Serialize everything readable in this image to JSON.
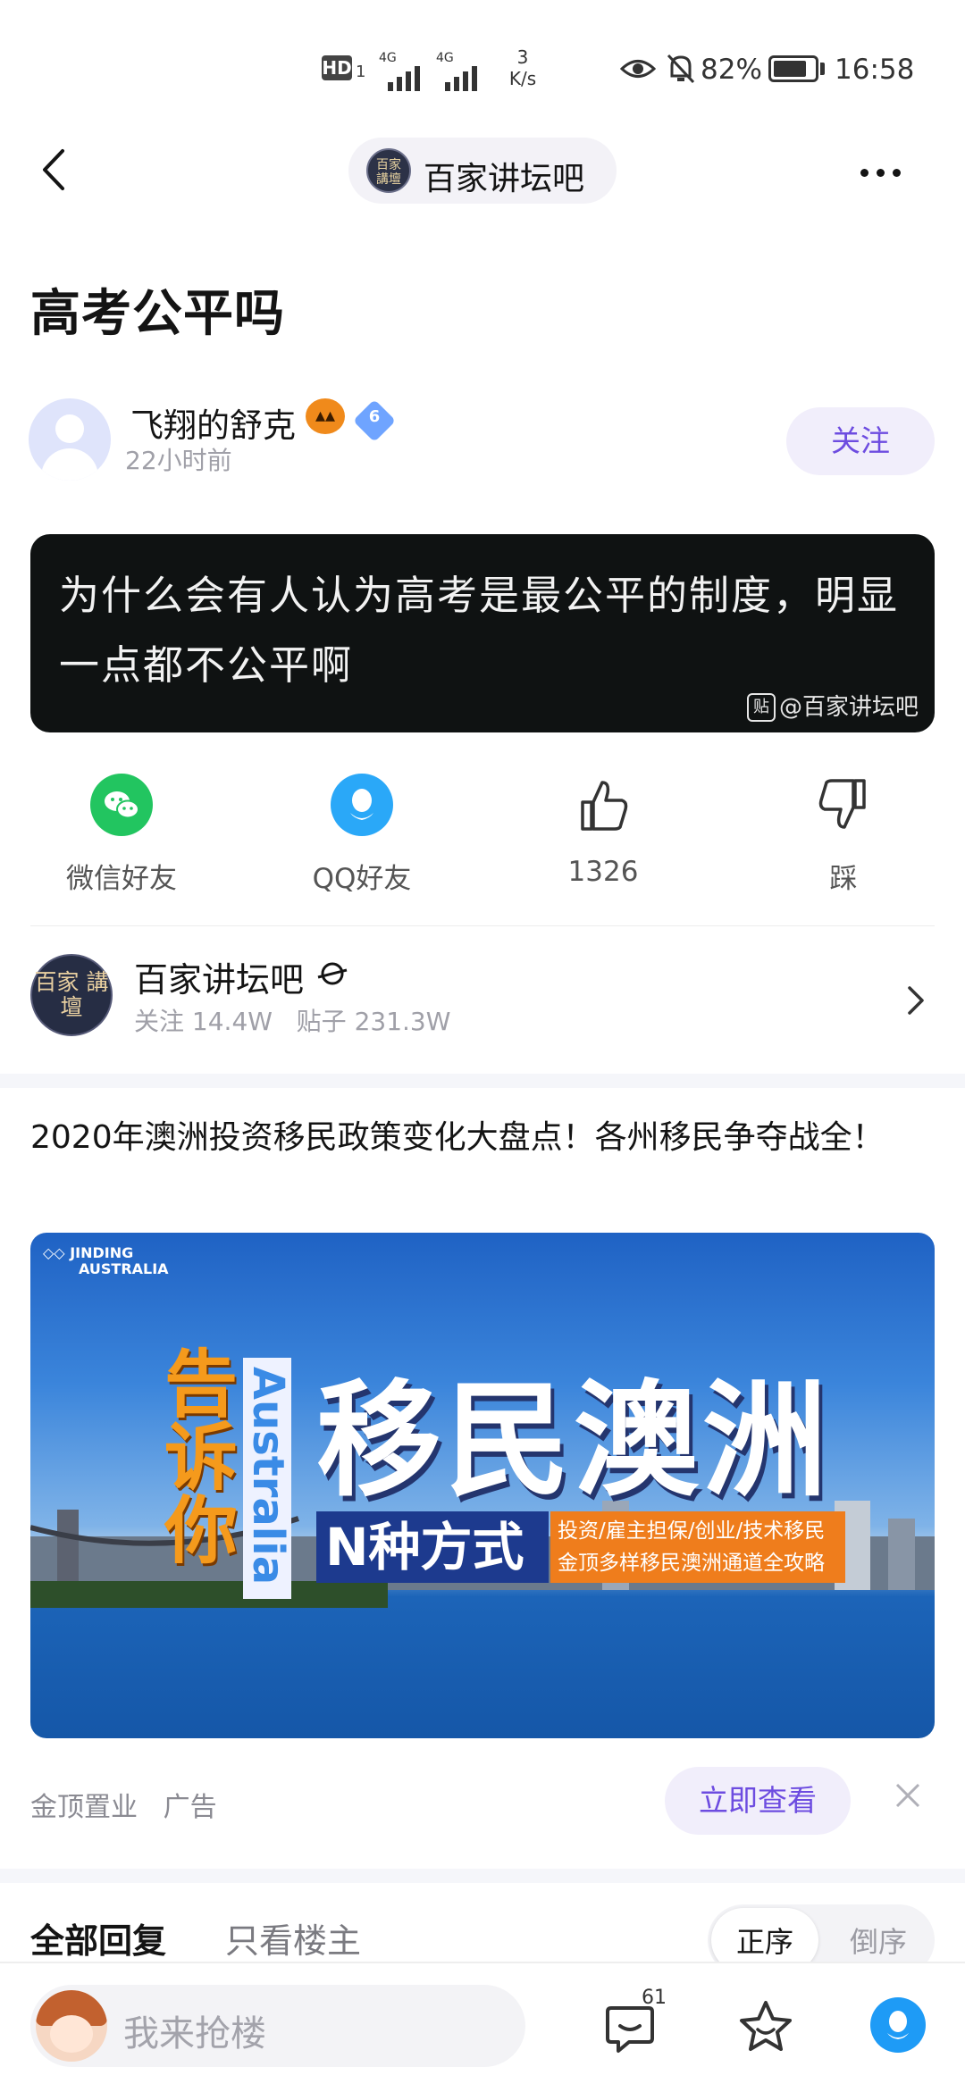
{
  "status_bar": {
    "hd": "HD",
    "sim_slot": "1",
    "net1": "4G",
    "net2": "4G",
    "speed_value": "3",
    "speed_unit": "K/s",
    "battery": "82%",
    "battery_level": 0.82,
    "time": "16:58"
  },
  "header": {
    "forum_name": "百家讲坛吧",
    "forum_mini_logo": "百家 講壇"
  },
  "post": {
    "title": "高考公平吗",
    "author": "飞翔的舒克",
    "author_level": "6",
    "time": "22小时前",
    "follow_label": "关注",
    "quote_text": "为什么会有人认为高考是最公平的制度，明显一点都不公平啊",
    "quote_watermark": "@百家讲坛吧",
    "watermark_icon_text": "贴"
  },
  "share_row": [
    {
      "label": "微信好友",
      "icon": "wechat-icon"
    },
    {
      "label": "QQ好友",
      "icon": "qq-icon"
    },
    {
      "label": "1326",
      "icon": "thumbs-up-icon"
    },
    {
      "label": "踩",
      "icon": "thumbs-down-icon"
    }
  ],
  "forum_card": {
    "name": "百家讲坛吧",
    "logo_text": "百家 講壇",
    "follow_label": "关注",
    "follow_count": "14.4W",
    "posts_label": "贴子",
    "posts_count": "231.3W"
  },
  "ad": {
    "title": "2020年澳洲投资移民政策变化大盘点！各州移民争夺战全！",
    "brand_line1": "JINDING",
    "brand_line2": "AUSTRALIA",
    "headline": "移民澳洲",
    "tell_you": "告诉你",
    "australia": "Australia",
    "band": "N种方式",
    "sub1": "投资/雇主担保/创业/技术移民",
    "sub2": "金顶多样移民澳洲通道全攻略",
    "sponsor": "金顶置业",
    "ad_tag": "广告",
    "cta": "立即查看"
  },
  "replies": {
    "all_tab": "全部回复",
    "host_tab": "只看楼主",
    "order_asc": "正序",
    "order_desc": "倒序"
  },
  "bottom_bar": {
    "input_placeholder": "我来抢楼",
    "reply_count": "61"
  },
  "colors": {
    "accent": "#6d4ce0",
    "wechat": "#22c560",
    "qq": "#2aa8f8"
  }
}
